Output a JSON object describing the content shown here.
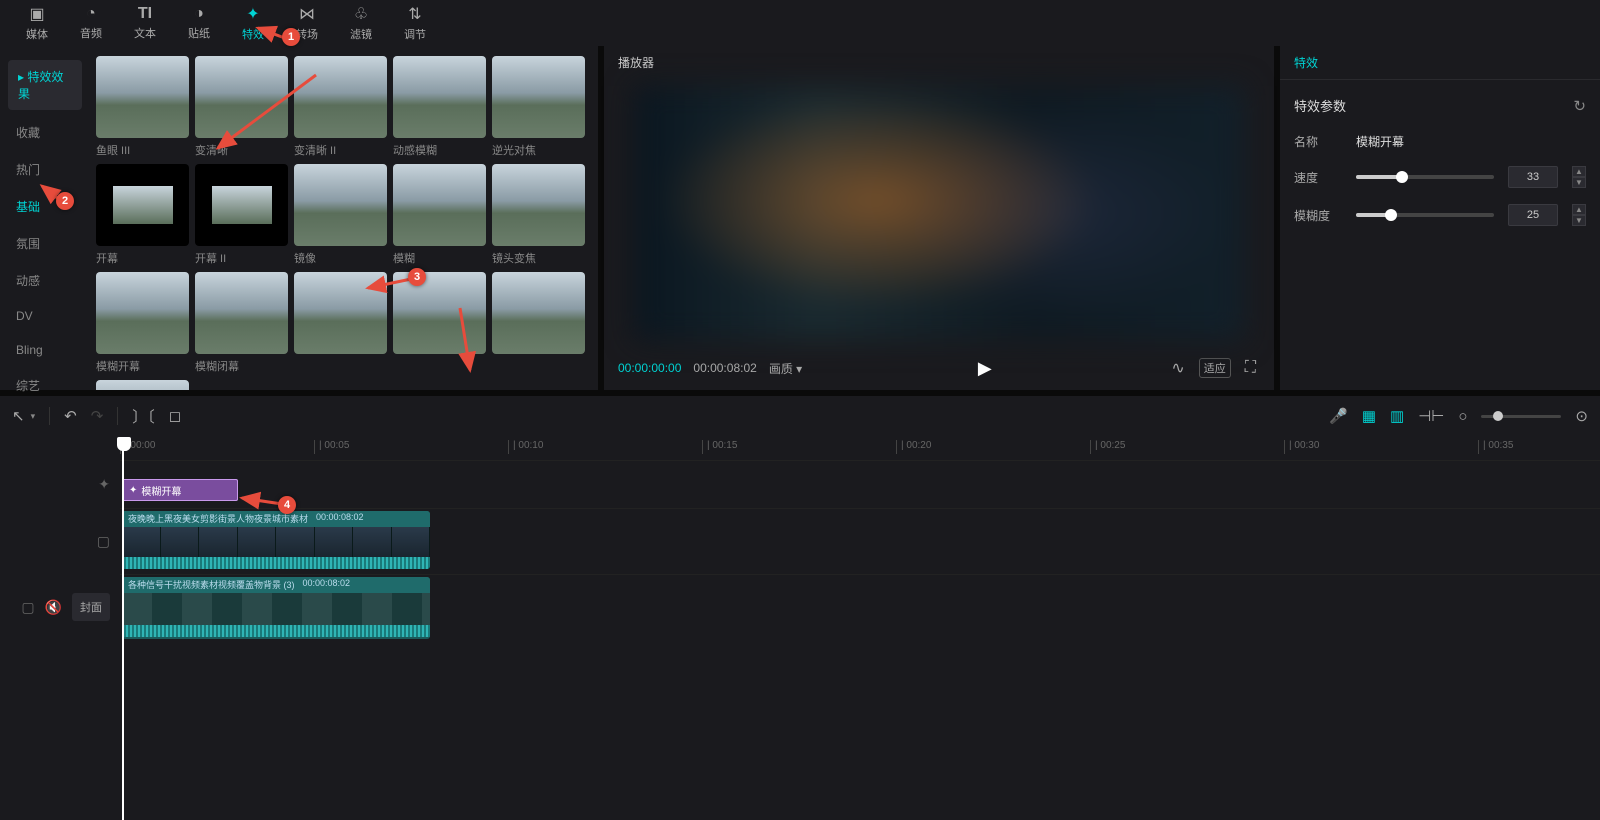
{
  "toolbar": {
    "items": [
      {
        "icon": "▣",
        "label": "媒体"
      },
      {
        "icon": "◔",
        "label": "音频"
      },
      {
        "icon": "TI",
        "label": "文本"
      },
      {
        "icon": "◑",
        "label": "贴纸"
      },
      {
        "icon": "✦",
        "label": "特效",
        "active": true
      },
      {
        "icon": "⋈",
        "label": "转场"
      },
      {
        "icon": "♧",
        "label": "滤镜"
      },
      {
        "icon": "⇅",
        "label": "调节"
      }
    ]
  },
  "categories": {
    "header": "特效效果",
    "items": [
      "收藏",
      "热门",
      "基础",
      "氛围",
      "动感",
      "DV",
      "Bling",
      "综艺"
    ],
    "selected": "基础"
  },
  "effects": [
    {
      "label": "鱼眼 III"
    },
    {
      "label": "变清晰"
    },
    {
      "label": "变清晰 II"
    },
    {
      "label": "动感模糊"
    },
    {
      "label": "逆光对焦"
    },
    {
      "label": "开幕",
      "thumb": "dark"
    },
    {
      "label": "开幕 II",
      "thumb": "dark"
    },
    {
      "label": "镜像"
    },
    {
      "label": "模糊"
    },
    {
      "label": "镜头变焦"
    },
    {
      "label": "模糊开幕"
    },
    {
      "label": "模糊闭幕"
    },
    {
      "label": ""
    },
    {
      "label": ""
    },
    {
      "label": ""
    },
    {
      "label": "",
      "thumb": "dl"
    }
  ],
  "player": {
    "title": "播放器",
    "current_time": "00:00:00:00",
    "total_time": "00:00:08:02",
    "quality": "画质",
    "fit_label": "适应"
  },
  "props": {
    "tab": "特效",
    "section": "特效参数",
    "name_label": "名称",
    "name_value": "模糊开幕",
    "speed_label": "速度",
    "speed_value": "33",
    "blur_label": "模糊度",
    "blur_value": "25"
  },
  "timeline": {
    "ticks": [
      "00:00",
      "00:05",
      "00:10",
      "00:15",
      "00:20",
      "00:25",
      "00:30",
      "00:35"
    ],
    "effect_clip": "模糊开幕",
    "clip1_name": "夜晚晚上黑夜美女剪影街景人物夜景城市素材",
    "clip1_dur": "00:00:08:02",
    "clip2_name": "各种信号干扰视频素材视频覆盖物背景 (3)",
    "clip2_dur": "00:00:08:02",
    "cover_btn": "封面"
  },
  "annotations": [
    "1",
    "2",
    "3",
    "4"
  ]
}
